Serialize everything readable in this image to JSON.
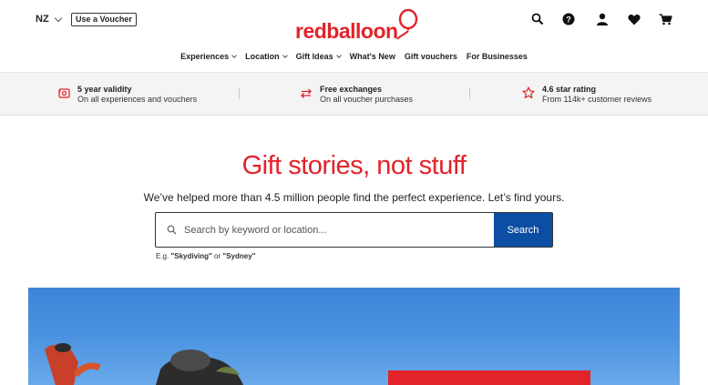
{
  "header": {
    "region": "NZ",
    "voucher_button": "Use a Voucher",
    "logo_text": "redballoon",
    "icons": [
      "search-icon",
      "help-icon",
      "account-icon",
      "wishlist-icon",
      "cart-icon"
    ]
  },
  "nav": {
    "items": [
      {
        "label": "Experiences",
        "dropdown": true
      },
      {
        "label": "Location",
        "dropdown": true
      },
      {
        "label": "Gift Ideas",
        "dropdown": true
      },
      {
        "label": "What's New",
        "dropdown": false
      },
      {
        "label": "Gift vouchers",
        "dropdown": false
      },
      {
        "label": "For Businesses",
        "dropdown": false
      }
    ]
  },
  "usp": [
    {
      "title": "5 year validity",
      "subtitle": "On all experiences and vouchers",
      "icon": "voucher-icon"
    },
    {
      "title": "Free exchanges",
      "subtitle": "On all voucher purchases",
      "icon": "exchange-icon"
    },
    {
      "title": "4.6 star rating",
      "subtitle": "From 114k+ customer reviews",
      "icon": "star-icon"
    }
  ],
  "hero": {
    "title": "Gift stories, not stuff",
    "subtitle": "We’ve helped more than 4.5 million people find the perfect experience. Let’s find yours.",
    "search_placeholder": "Search by keyword or location...",
    "search_button": "Search",
    "example_prefix": "E.g. ",
    "example_1": "\"Skydiving\"",
    "example_or": " or ",
    "example_2": "\"Sydney\""
  },
  "colors": {
    "brand_red": "#e2232a",
    "search_blue": "#0c4ea3",
    "banner_sky": "#4b93e0"
  }
}
